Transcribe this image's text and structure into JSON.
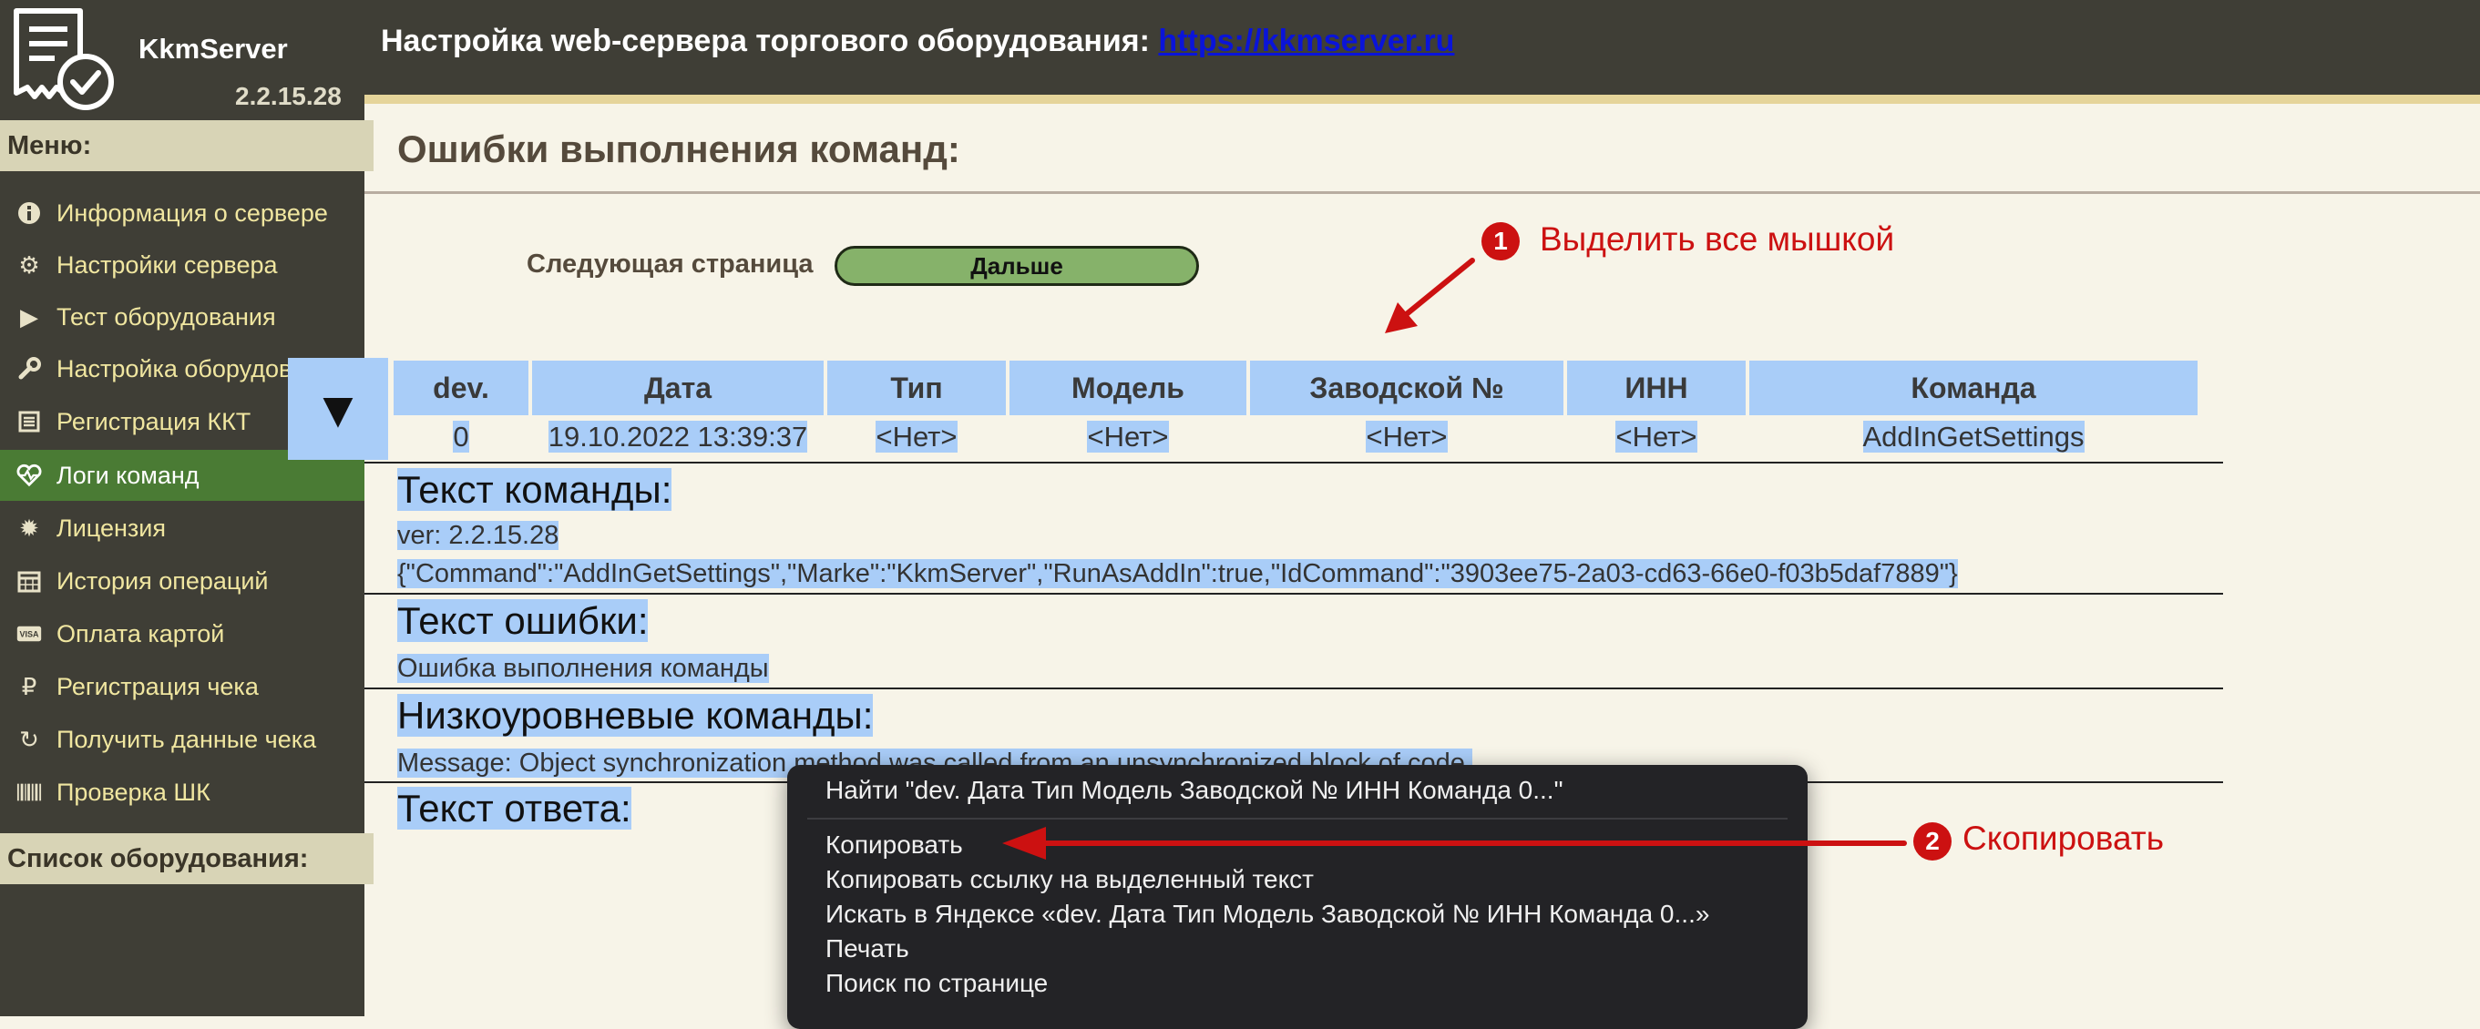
{
  "header": {
    "title": "Настройка web-сервера торгового оборудования:",
    "link": "https://kkmserver.ru"
  },
  "app": {
    "name": "KkmServer",
    "version": "2.2.15.28"
  },
  "sidebar": {
    "menu_heading": "Меню:",
    "items": [
      {
        "label": "Информация о сервере",
        "icon": "info-icon"
      },
      {
        "label": "Настройки сервера",
        "icon": "gears-icon"
      },
      {
        "label": "Тест оборудования",
        "icon": "play-icon"
      },
      {
        "label": "Настройка оборудования",
        "icon": "wrench-icon"
      },
      {
        "label": "Регистрация ККТ",
        "icon": "list-icon"
      },
      {
        "label": "Логи команд",
        "icon": "heartbeat-icon"
      },
      {
        "label": "Лицензия",
        "icon": "certificate-icon"
      },
      {
        "label": "История операций",
        "icon": "calendar-icon"
      },
      {
        "label": "Оплата картой",
        "icon": "visa-card-icon"
      },
      {
        "label": "Регистрация чека",
        "icon": "ruble-icon"
      },
      {
        "label": "Получить данные чека",
        "icon": "refresh-icon"
      },
      {
        "label": "Проверка ШК",
        "icon": "barcode-icon"
      }
    ],
    "active_index": 5,
    "equipment_heading": "Список оборудования:"
  },
  "page": {
    "title": "Ошибки выполнения команд:",
    "next_label": "Следующая страница",
    "next_button": "Дальше"
  },
  "table": {
    "headers": [
      "dev.",
      "Дата",
      "Тип",
      "Модель",
      "Заводской №",
      "ИНН",
      "Команда"
    ],
    "row": [
      "0",
      "19.10.2022 13:39:37",
      "<Нет>",
      "<Нет>",
      "<Нет>",
      "<Нет>",
      "AddInGetSettings"
    ]
  },
  "sections": {
    "command_title": "Текст команды:",
    "command_version": "ver: 2.2.15.28",
    "command_json": "{\"Command\":\"AddInGetSettings\",\"Marke\":\"KkmServer\",\"RunAsAddIn\":true,\"IdCommand\":\"3903ee75-2a03-cd63-66e0-f03b5daf7889\"}",
    "error_title": "Текст ошибки:",
    "error_text": "Ошибка выполнения команды",
    "lowlevel_title": "Низкоуровневые команды:",
    "lowlevel_text": "Message: Object synchronization method was called from an unsynchronized block of code.",
    "response_title": "Текст ответа:"
  },
  "context_menu": {
    "find": "Найти \"dev. Дата Тип Модель Заводской № ИНН Команда 0...\"",
    "copy": "Копировать",
    "copy_link": "Копировать ссылку на выделенный текст",
    "search_yandex": "Искать в Яндексе «dev. Дата Тип Модель Заводской № ИНН Команда 0...»",
    "print": "Печать",
    "find_on_page": "Поиск по странице"
  },
  "annotations": {
    "step1_num": "1",
    "step1_text": "Выделить все мышкой",
    "step2_num": "2",
    "step2_text": "Скопировать"
  },
  "colors": {
    "sidebar_bg": "#3f3e36",
    "active_item": "#4a7b34",
    "selection": "#a9cdf8",
    "annotation": "#cc1111",
    "button_green": "#86b26a"
  }
}
